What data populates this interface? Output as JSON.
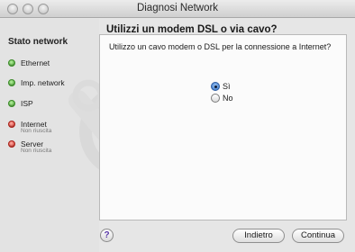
{
  "window": {
    "title": "Diagnosi Network"
  },
  "sidebar": {
    "title": "Stato network",
    "items": [
      {
        "label": "Ethernet",
        "status": "ok",
        "sub": ""
      },
      {
        "label": "Imp. network",
        "status": "ok",
        "sub": ""
      },
      {
        "label": "ISP",
        "status": "ok",
        "sub": ""
      },
      {
        "label": "Internet",
        "status": "fail",
        "sub": "Non riuscita"
      },
      {
        "label": "Server",
        "status": "fail",
        "sub": "Non riuscita"
      }
    ]
  },
  "main": {
    "heading": "Utilizzi un modem DSL o via cavo?",
    "question": "Utilizzo un cavo modem o DSL per la connessione a Internet?",
    "options": [
      {
        "label": "Sì",
        "selected": true
      },
      {
        "label": "No",
        "selected": false
      }
    ]
  },
  "footer": {
    "help_label": "?",
    "back_label": "Indietro",
    "next_label": "Continua"
  },
  "colors": {
    "ok": "#3fa02a",
    "fail": "#d02a20",
    "radio_selected": "#2f6fc4"
  }
}
